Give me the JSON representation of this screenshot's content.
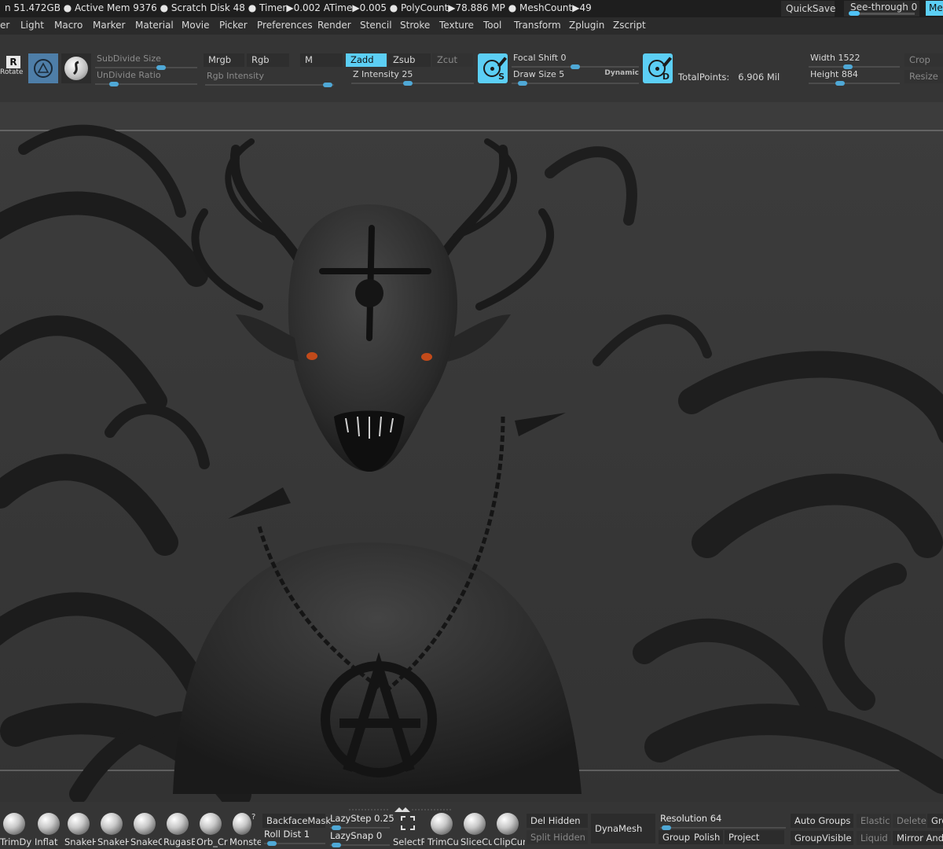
{
  "status": {
    "text": "n 51.472GB ● Active Mem 9376 ● Scratch Disk 48 ●  Timer▶0.002 ATime▶0.005 ● PolyCount▶78.886 MP  ● MeshCount▶49",
    "quicksave": "QuickSave",
    "seethrough": "See-through  0",
    "menu_button": "Me",
    "seethrough_level": 0
  },
  "menus": [
    "er",
    "Light",
    "Macro",
    "Marker",
    "Material",
    "Movie",
    "Picker",
    "Preferences",
    "Render",
    "Stencil",
    "Stroke",
    "Texture",
    "Tool",
    "Transform",
    "Zplugin",
    "Zscript"
  ],
  "toolbar": {
    "rotate_label": "Rotate",
    "rotate_key": "R",
    "subdivide_size": "SubDivide Size",
    "undivide_ratio": "UnDivide Ratio",
    "mrgb": "Mrgb",
    "rgb": "Rgb",
    "rgb_intensity": "Rgb Intensity",
    "m": "M",
    "zadd": "Zadd",
    "zsub": "Zsub",
    "zcut": "Zcut",
    "z_intensity": "Z Intensity 25",
    "focal_shift": "Focal Shift 0",
    "draw_size": "Draw Size 5",
    "dynamic": "Dynamic",
    "icon_s_letter": "S",
    "icon_d_letter": "D",
    "total_points_label": "TotalPoints:",
    "total_points_value": "6.906 Mil",
    "width": "Width 1522",
    "height": "Height 884",
    "crop": "Crop",
    "resize": "Resize"
  },
  "shelf": {
    "brushes": [
      "TrimDy",
      "Inflat",
      "SnakeH",
      "SnakeH",
      "SnakeC",
      "RugasB",
      "Orb_Cr",
      "Monste"
    ],
    "backface_mask": "BackfaceMask",
    "roll_dist": "Roll Dist 1",
    "lazy_step": "LazyStep 0.25",
    "lazy_snap": "LazySnap 0",
    "select_rect": "SelectRe",
    "trim_curve": "TrimCu",
    "slice_curve": "SliceCu",
    "clip_curve": "ClipCur",
    "del_hidden": "Del Hidden",
    "split_hidden": "Split Hidden",
    "dynamesh": "DynaMesh",
    "resolution": "Resolution 64",
    "groups": "Group:",
    "polish": "Polish",
    "project": "Project",
    "auto_groups": "Auto Groups",
    "group_visible": "GroupVisible",
    "elastic": "Elastic",
    "liquid": "Liquid",
    "delete": "Delete",
    "mirror_and": "Mirror And",
    "gro": "Gro",
    "help_mark": "?"
  }
}
